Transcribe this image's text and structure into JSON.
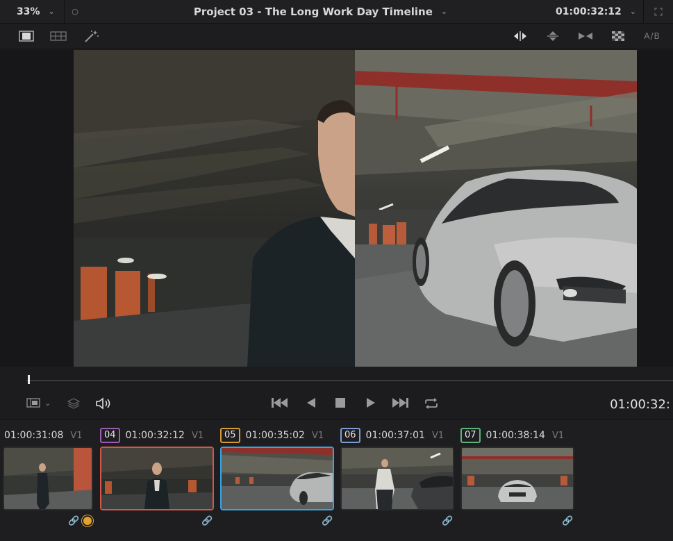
{
  "viewer_header": {
    "zoom": "33%",
    "title": "Project 03 -  The Long Work Day Timeline",
    "timecode": "01:00:32:12"
  },
  "toolbar": {
    "left_icons": [
      "single-viewer-icon",
      "grid-viewer-icon",
      "magic-wand-icon"
    ],
    "right_icons": [
      "split-horizontal-icon",
      "split-vertical-icon",
      "wipe-icon",
      "checkerboard-icon"
    ],
    "ab_label": "A/B"
  },
  "transport": {
    "timecode": "01:00:32:"
  },
  "clips": [
    {
      "number": "",
      "timecode": "01:00:31:08",
      "track": "V1",
      "linked": true,
      "fx": true,
      "selected": ""
    },
    {
      "number": "04",
      "timecode": "01:00:32:12",
      "track": "V1",
      "linked": true,
      "fx": false,
      "selected": "red"
    },
    {
      "number": "05",
      "timecode": "01:00:35:02",
      "track": "V1",
      "linked": true,
      "fx": false,
      "selected": "blue"
    },
    {
      "number": "06",
      "timecode": "01:00:37:01",
      "track": "V1",
      "linked": true,
      "fx": false,
      "selected": ""
    },
    {
      "number": "07",
      "timecode": "01:00:38:14",
      "track": "V1",
      "linked": true,
      "fx": false,
      "selected": ""
    }
  ],
  "colors": {
    "selected_red": "#d2584a",
    "selected_blue": "#35a6e6",
    "link_green": "#8fc43a",
    "fx_orange": "#e0a232"
  }
}
